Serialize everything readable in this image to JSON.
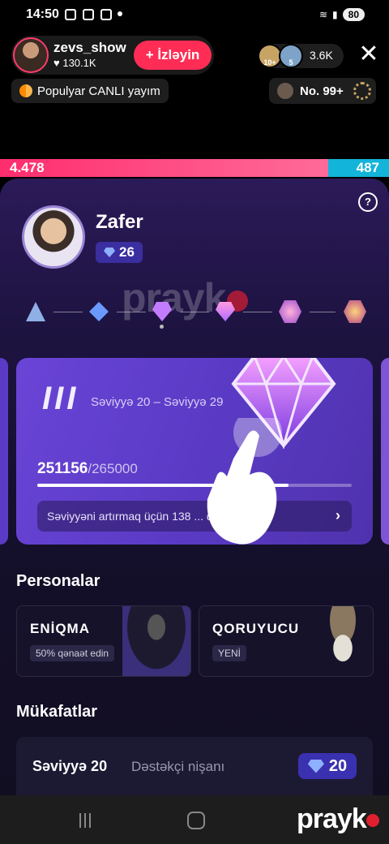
{
  "status_bar": {
    "time": "14:50",
    "battery": "80"
  },
  "host": {
    "name": "zevs_show",
    "likes": "130.1K",
    "follow_label": "+ İzləyin"
  },
  "viewers": {
    "count": "3.6K",
    "badge1": "10+",
    "badge2": "5"
  },
  "live_tag": {
    "label": "Populyar CANLI yayım"
  },
  "rank": {
    "label": "No. 99+"
  },
  "battle": {
    "left_score": "4.478",
    "right_score": "487"
  },
  "watermark": {
    "text": "prayk"
  },
  "profile": {
    "name": "Zafer",
    "level": "26"
  },
  "level_card": {
    "roman": "III",
    "range": "Səviyyə 20 – Səviyyə 29",
    "current": "251156",
    "total": "/265000",
    "progress_fraction": 0.8,
    "hint": "Səviyyəni artırmaq üçün 138 ... dır"
  },
  "personas": {
    "title": "Personalar",
    "items": [
      {
        "name": "ENİQMA",
        "badge": "50% qənaət edin"
      },
      {
        "name": "QORUYUCU",
        "badge": "YENİ"
      }
    ]
  },
  "rewards": {
    "title": "Mükafatlar",
    "row": {
      "level": "Səviyyə 20",
      "desc": "Dəstəkçi nişanı",
      "value": "20"
    }
  },
  "brand": {
    "text": "prayk"
  },
  "colors": {
    "accent": "#ff2d55",
    "card": "#5b3bc6",
    "battle_left": "#ff2d6e",
    "battle_right": "#12b4d9"
  }
}
